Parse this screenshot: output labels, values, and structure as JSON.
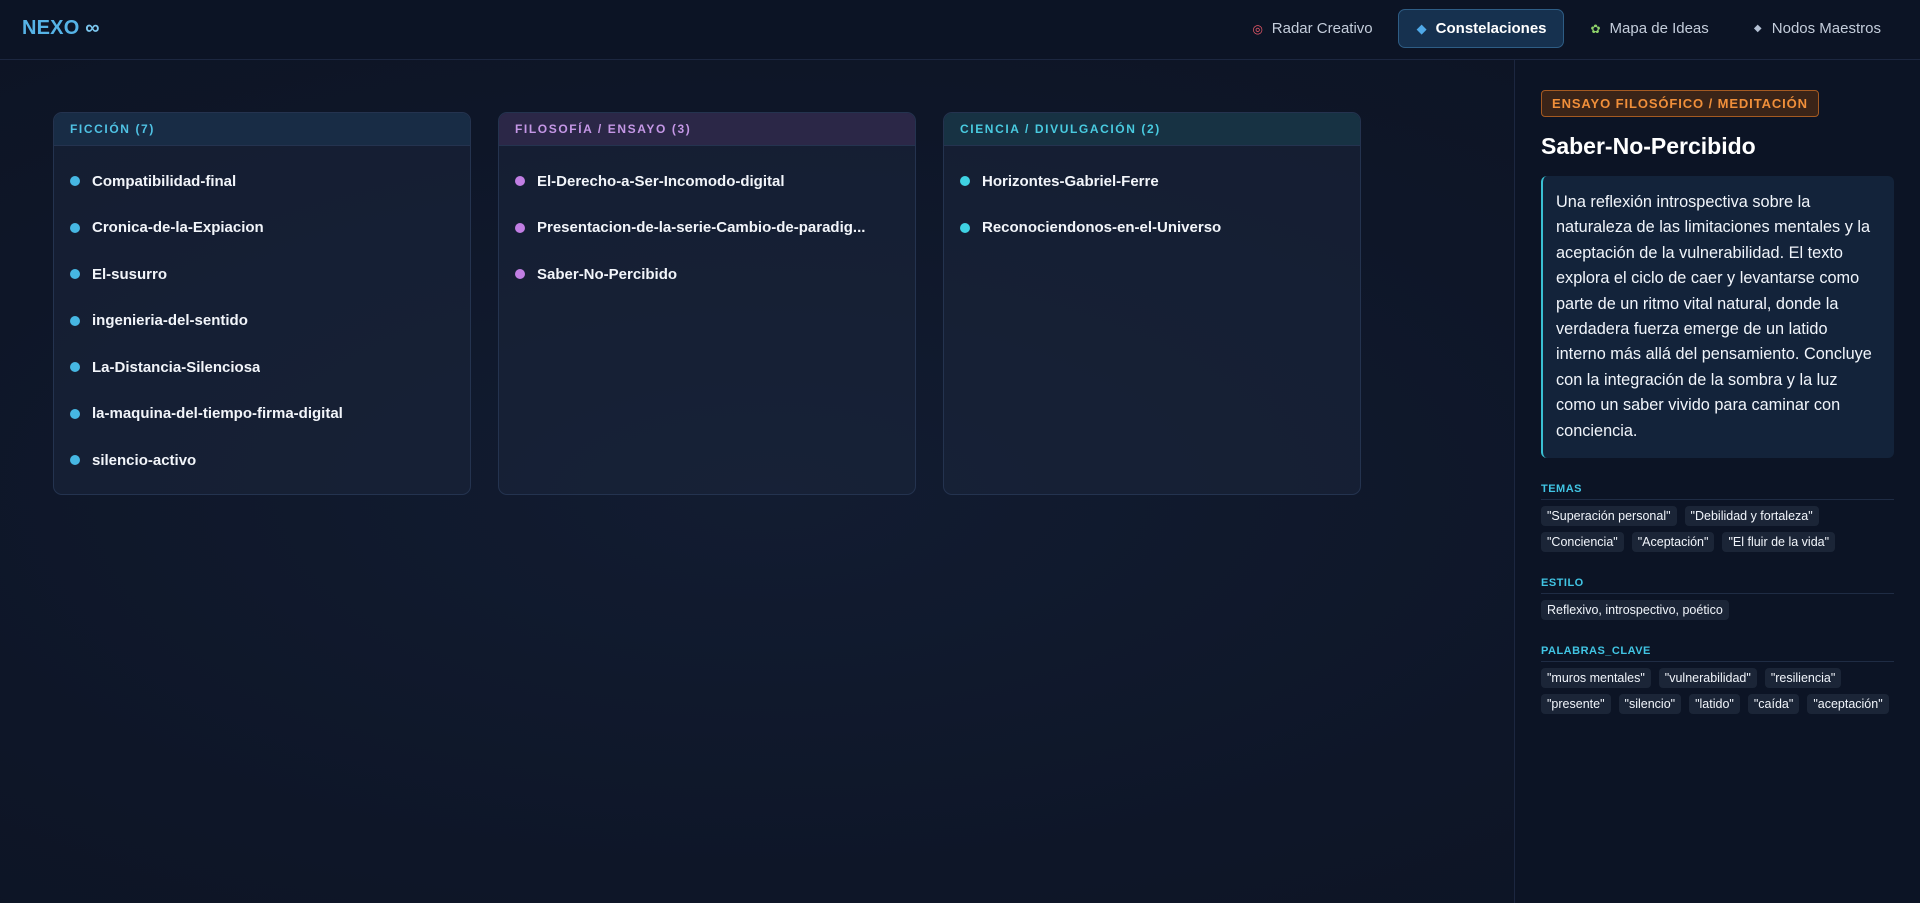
{
  "brand": {
    "name": "NEXO",
    "symbol": "∞"
  },
  "nav": {
    "tabs": [
      {
        "label": "Radar Creativo",
        "icon": "target-icon",
        "active": false
      },
      {
        "label": "Constelaciones",
        "icon": "diamond-icon",
        "active": true
      },
      {
        "label": "Mapa de Ideas",
        "icon": "sprout-icon",
        "active": false
      },
      {
        "label": "Nodos Maestros",
        "icon": "small-diamond-icon",
        "active": false
      }
    ]
  },
  "columns": [
    {
      "title": "FICCIÓN (7)",
      "accent": "#46b7e3",
      "items": [
        "Compatibilidad-final",
        "Cronica-de-la-Expiacion",
        "El-susurro",
        "ingenieria-del-sentido",
        "La-Distancia-Silenciosa",
        "la-maquina-del-tiempo-firma-digital",
        "silencio-activo"
      ]
    },
    {
      "title": "FILOSOFÍA / ENSAYO (3)",
      "accent": "#c17ee3",
      "items": [
        "El-Derecho-a-Ser-Incomodo-digital",
        "Presentacion-de-la-serie-Cambio-de-paradig...",
        "Saber-No-Percibido"
      ]
    },
    {
      "title": "CIENCIA / DIVULGACIÓN (2)",
      "accent": "#3fd2e3",
      "items": [
        "Horizontes-Gabriel-Ferre",
        "Reconociendonos-en-el-Universo"
      ]
    }
  ],
  "detail": {
    "genre": "ENSAYO FILOSÓFICO / MEDITACIÓN",
    "title": "Saber-No-Percibido",
    "summary": "Una reflexión introspectiva sobre la naturaleza de las limitaciones mentales y la aceptación de la vulnerabilidad. El texto explora el ciclo de caer y levantarse como parte de un ritmo vital natural, donde la verdadera fuerza emerge de un latido interno más allá del pensamiento. Concluye con la integración de la sombra y la luz como un saber vivido para caminar con conciencia.",
    "temas_label": "TEMAS",
    "temas": [
      "\"Superación personal\"",
      "\"Debilidad y fortaleza\"",
      "\"Conciencia\"",
      "\"Aceptación\"",
      "\"El fluir de la vida\""
    ],
    "estilo_label": "ESTILO",
    "estilo": [
      "Reflexivo, introspectivo, poético"
    ],
    "palabras_label": "PALABRAS_CLAVE",
    "palabras": [
      "\"muros mentales\"",
      "\"vulnerabilidad\"",
      "\"resiliencia\"",
      "\"presente\"",
      "\"silencio\"",
      "\"latido\"",
      "\"caída\"",
      "\"aceptación\""
    ]
  }
}
